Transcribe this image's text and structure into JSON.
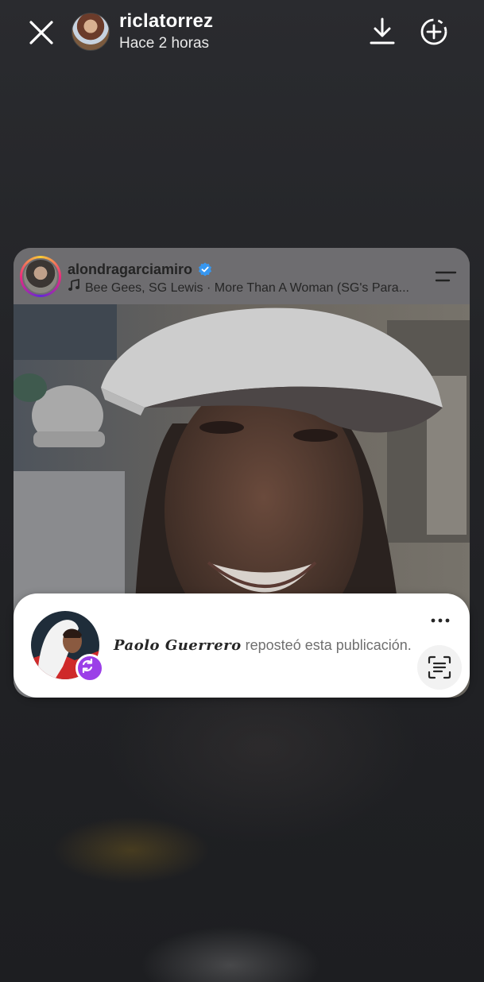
{
  "header": {
    "username": "riclatorrez",
    "time": "Hace 2 horas"
  },
  "post": {
    "username": "alondragarciamiro",
    "music": "Bee Gees, SG Lewis · More Than A Woman (SG's Para..."
  },
  "repost": {
    "name": "Paolo Guerrero",
    "text": " reposteó esta publicación."
  },
  "icons": {
    "close": "close-icon",
    "download": "download-icon",
    "add": "add-story-icon",
    "verified": "verified-badge-icon",
    "music": "music-note-icon",
    "menu": "menu-icon",
    "more": "more-options-icon",
    "repost_badge": "repost-icon",
    "scan": "text-scan-icon"
  },
  "colors": {
    "verified": "#3797f0",
    "repost_badge": "#9b3fe8"
  }
}
